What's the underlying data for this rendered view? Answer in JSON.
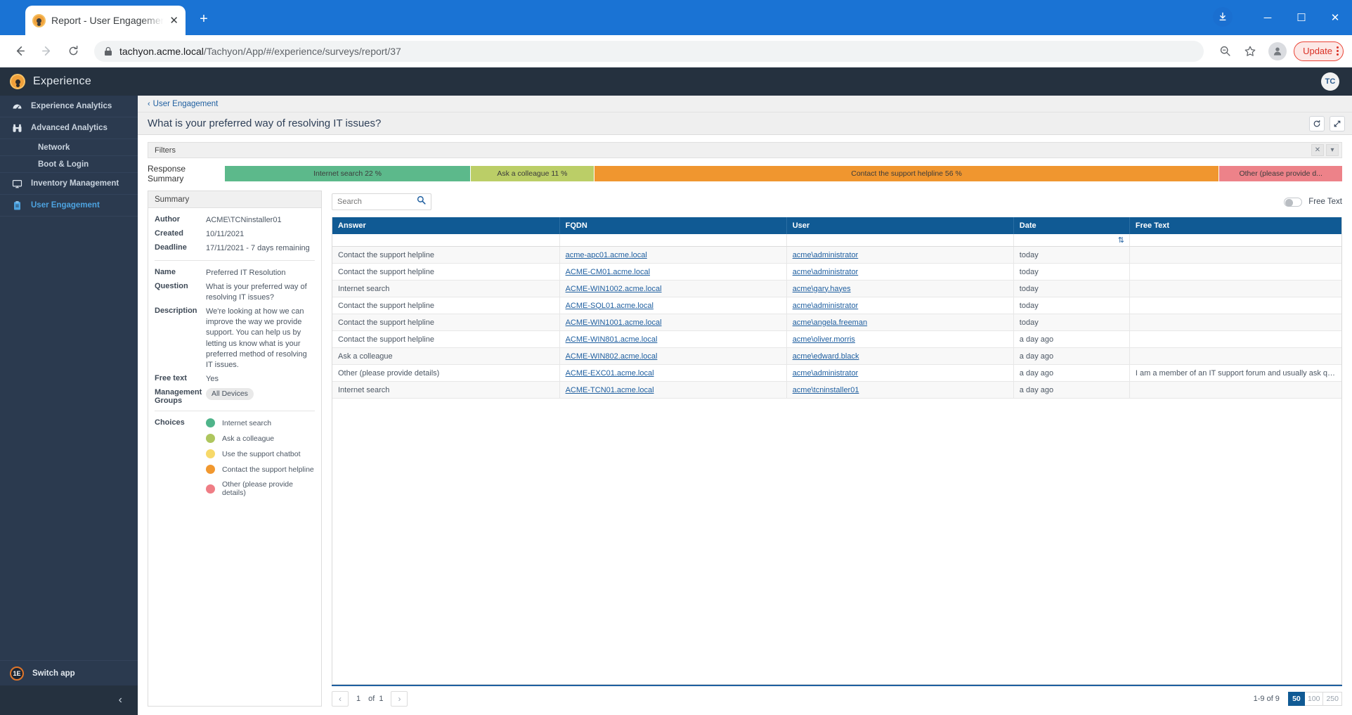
{
  "browser": {
    "tab_title": "Report - User Engagement - Exp",
    "url_secure": "tachyon.acme.local",
    "url_path": "/Tachyon/App/#/experience/surveys/report/37",
    "update_label": "Update",
    "new_tab_label": "+",
    "close_tab_label": "✕",
    "minimize_label": "─",
    "maximize_label": "☐",
    "window_close_label": "✕"
  },
  "sidebar": {
    "brand": "Experience",
    "items": [
      {
        "label": "Experience Analytics",
        "icon": "gauge-icon",
        "active": false
      },
      {
        "label": "Advanced Analytics",
        "icon": "binoculars-icon",
        "active": false
      },
      {
        "label": "Inventory Management",
        "icon": "monitor-icon",
        "active": false
      },
      {
        "label": "User Engagement",
        "icon": "clipboard-icon",
        "active": true
      }
    ],
    "sub_items": [
      "Network",
      "Boot & Login"
    ],
    "switch_app": "Switch app",
    "switch_app_badge": "1E",
    "collapse": "‹"
  },
  "header": {
    "avatar_initials": "TC",
    "breadcrumb": "User Engagement",
    "breadcrumb_chevron": "‹",
    "page_title": "What is your preferred way of resolving IT issues?",
    "refresh_icon": "↻",
    "expand_icon": "⤡"
  },
  "filters": {
    "label": "Filters",
    "clear_icon": "✕",
    "collapse_icon": "▾"
  },
  "response_summary": {
    "label": "Response Summary",
    "segments": [
      {
        "label": "Internet search 22 %",
        "percent": 22,
        "color": "#5cb98b"
      },
      {
        "label": "Ask a colleague 11 %",
        "percent": 11,
        "color": "#bbce67"
      },
      {
        "label": "Contact the support helpline 56 %",
        "percent": 56,
        "color": "#f0962f"
      },
      {
        "label": "Other (please provide d...",
        "percent": 11,
        "color": "#ed8289"
      }
    ]
  },
  "summary_panel": {
    "title": "Summary",
    "meta": [
      {
        "key": "Author",
        "value": "ACME\\TCNinstaller01"
      },
      {
        "key": "Created",
        "value": "10/11/2021"
      },
      {
        "key": "Deadline",
        "value": "17/11/2021 - 7 days remaining"
      }
    ],
    "details": [
      {
        "key": "Name",
        "value": "Preferred IT Resolution"
      },
      {
        "key": "Question",
        "value": "What is your preferred way of resolving IT issues?"
      },
      {
        "key": "Description",
        "value": "We're looking at how we can improve the way we provide support. You can help us by letting us know what is your preferred method of resolving IT issues."
      },
      {
        "key": "Free text",
        "value": "Yes"
      }
    ],
    "management_groups_key": "Management Groups",
    "management_groups_value": "All Devices",
    "choices_key": "Choices",
    "choices": [
      {
        "label": "Internet search",
        "color": "#4fb48a"
      },
      {
        "label": "Ask a colleague",
        "color": "#aec65e"
      },
      {
        "label": "Use the support chatbot",
        "color": "#f7d969"
      },
      {
        "label": "Contact the support helpline",
        "color": "#f1982f"
      },
      {
        "label": "Other (please provide details)",
        "color": "#ef7d85"
      }
    ]
  },
  "table_toolbar": {
    "search_value": "",
    "search_placeholder": "Search",
    "search_icon": "search-icon",
    "free_text_toggle_label": "Free Text",
    "free_text_toggle_on": false
  },
  "table": {
    "columns": [
      "Answer",
      "FQDN",
      "User",
      "Date",
      "Free Text"
    ],
    "sort_icon": "⇅",
    "rows": [
      {
        "answer": "Contact the support helpline",
        "fqdn": "acme-apc01.acme.local",
        "user": "acme\\administrator",
        "date": "today",
        "free_text": ""
      },
      {
        "answer": "Contact the support helpline",
        "fqdn": "ACME-CM01.acme.local",
        "user": "acme\\administrator",
        "date": "today",
        "free_text": ""
      },
      {
        "answer": "Internet search",
        "fqdn": "ACME-WIN1002.acme.local",
        "user": "acme\\gary.hayes",
        "date": "today",
        "free_text": ""
      },
      {
        "answer": "Contact the support helpline",
        "fqdn": "ACME-SQL01.acme.local",
        "user": "acme\\administrator",
        "date": "today",
        "free_text": ""
      },
      {
        "answer": "Contact the support helpline",
        "fqdn": "ACME-WIN1001.acme.local",
        "user": "acme\\angela.freeman",
        "date": "today",
        "free_text": ""
      },
      {
        "answer": "Contact the support helpline",
        "fqdn": "ACME-WIN801.acme.local",
        "user": "acme\\oliver.morris",
        "date": "a day ago",
        "free_text": ""
      },
      {
        "answer": "Ask a colleague",
        "fqdn": "ACME-WIN802.acme.local",
        "user": "acme\\edward.black",
        "date": "a day ago",
        "free_text": ""
      },
      {
        "answer": "Other (please provide details)",
        "fqdn": "ACME-EXC01.acme.local",
        "user": "acme\\administrator",
        "date": "a day ago",
        "free_text": "I am a member of an IT support forum and usually ask questions there."
      },
      {
        "answer": "Internet search",
        "fqdn": "ACME-TCN01.acme.local",
        "user": "acme\\tcninstaller01",
        "date": "a day ago",
        "free_text": ""
      }
    ]
  },
  "pager": {
    "prev_icon": "‹",
    "next_icon": "›",
    "page": "1",
    "of_label": "of",
    "total_pages": "1",
    "range_label": "1-9 of 9",
    "page_sizes": [
      "50",
      "100",
      "250"
    ],
    "selected_size": "50"
  }
}
